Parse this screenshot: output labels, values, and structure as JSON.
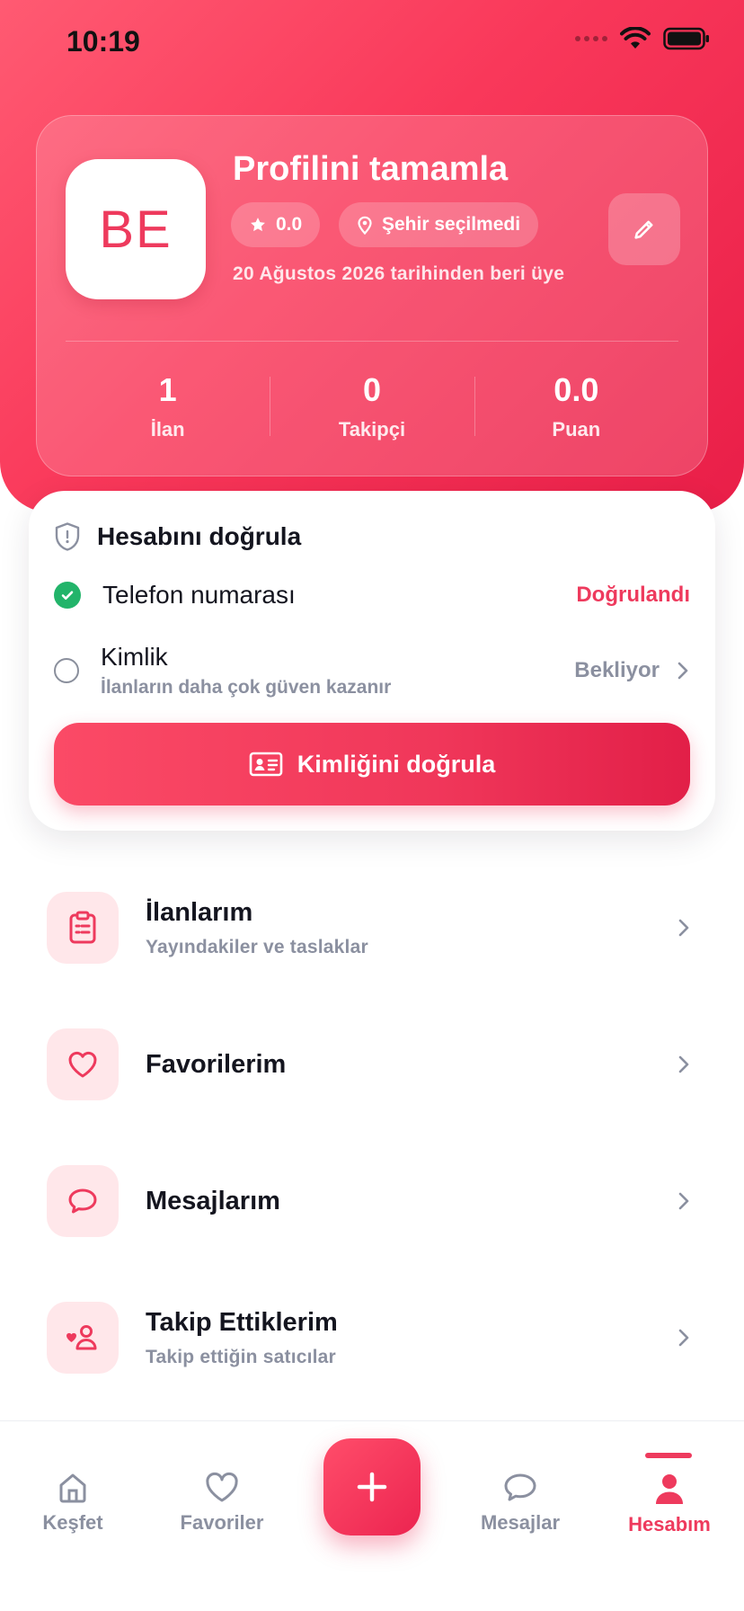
{
  "status_bar": {
    "time": "10:19"
  },
  "profile": {
    "initials": "BE",
    "title": "Profilini tamamla",
    "rating": "0.0",
    "city": "Şehir seçilmedi",
    "member_since": "20 Ağustos 2026 tarihinden beri üye",
    "stats": [
      {
        "value": "1",
        "label": "İlan"
      },
      {
        "value": "0",
        "label": "Takipçi"
      },
      {
        "value": "0.0",
        "label": "Puan"
      }
    ]
  },
  "verification": {
    "title": "Hesabını doğrula",
    "phone": {
      "label": "Telefon numarası",
      "status": "Doğrulandı"
    },
    "identity": {
      "label": "Kimlik",
      "sub": "İlanların daha çok güven kazanır",
      "status": "Bekliyor"
    },
    "button_label": "Kimliğini doğrula"
  },
  "menu": [
    {
      "title": "İlanlarım",
      "sub": "Yayındakiler ve taslaklar",
      "icon": "clipboard-list-icon"
    },
    {
      "title": "Favorilerim",
      "sub": "",
      "icon": "heart-icon"
    },
    {
      "title": "Mesajlarım",
      "sub": "",
      "icon": "message-icon"
    },
    {
      "title": "Takip Ettiklerim",
      "sub": "Takip ettiğin satıcılar",
      "icon": "user-heart-icon"
    }
  ],
  "tabs": [
    {
      "label": "Keşfet",
      "icon": "home-icon"
    },
    {
      "label": "Favoriler",
      "icon": "heart-icon"
    },
    {
      "label": "Mesajlar",
      "icon": "message-icon"
    },
    {
      "label": "Hesabım",
      "icon": "user-icon",
      "active": true
    }
  ],
  "colors": {
    "accent": "#EE3A5D",
    "success": "#22B46A",
    "muted": "#8B90A0",
    "icon_bg": "#FFE7EA"
  }
}
